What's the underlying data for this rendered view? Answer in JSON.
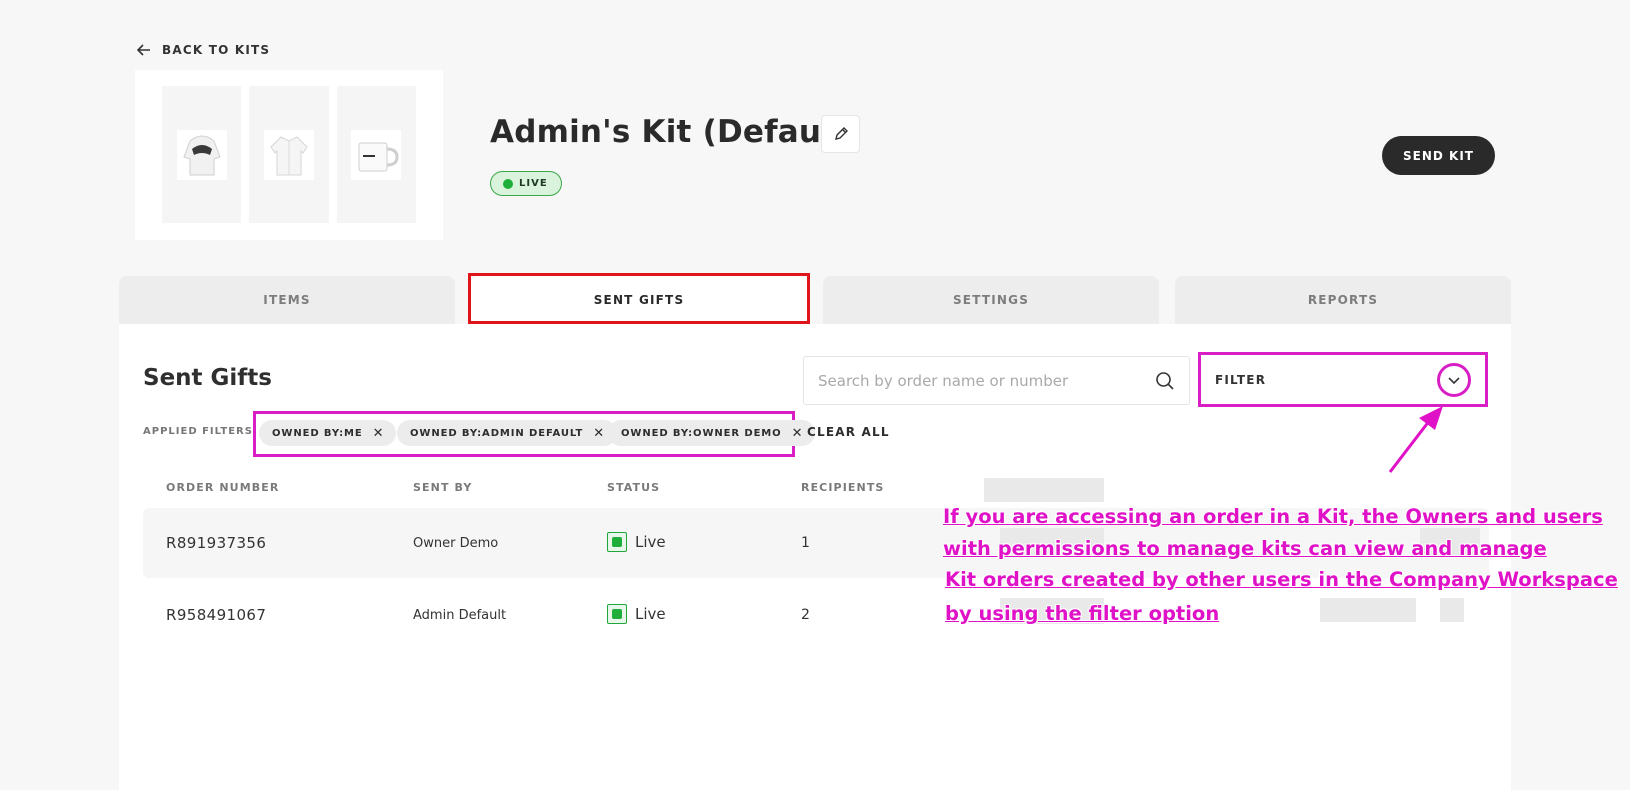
{
  "nav": {
    "back_label": "BACK TO KITS"
  },
  "kit": {
    "title": "Admin's Kit (Default)",
    "status_label": "LIVE",
    "send_label": "SEND KIT",
    "thumbnails": [
      "hoodie-image",
      "jacket-image",
      "mug-image"
    ]
  },
  "tabs": [
    {
      "label": "ITEMS",
      "active": false
    },
    {
      "label": "SENT GIFTS",
      "active": true
    },
    {
      "label": "SETTINGS",
      "active": false
    },
    {
      "label": "REPORTS",
      "active": false
    }
  ],
  "sent_gifts": {
    "title": "Sent Gifts",
    "search_placeholder": "Search by order name or number",
    "filter_label": "FILTER",
    "applied_filters_label": "APPLIED FILTERS:",
    "chips": [
      "OWNED BY:ME",
      "OWNED BY:ADMIN DEFAULT",
      "OWNED BY:OWNER DEMO"
    ],
    "clear_all_label": "CLEAR ALL"
  },
  "table": {
    "columns": [
      "ORDER NUMBER",
      "SENT BY",
      "STATUS",
      "RECIPIENTS"
    ],
    "rows": [
      {
        "order": "R891937356",
        "sent_by": "Owner Demo",
        "status": "Live",
        "recipients": "1"
      },
      {
        "order": "R958491067",
        "sent_by": "Admin Default",
        "status": "Live",
        "recipients": "2"
      }
    ]
  },
  "annotation": {
    "lines": [
      "If you are accessing an order in a Kit, the Owners and users",
      "with permissions to manage kits can view and manage",
      "Kit orders created by other users in the Company Workspace",
      "by using the filter option"
    ]
  },
  "colors": {
    "highlight_red": "#e0141b",
    "annotation_magenta": "#e012c8",
    "live_green": "#1fae3a",
    "dark_button": "#2a2a2a"
  }
}
